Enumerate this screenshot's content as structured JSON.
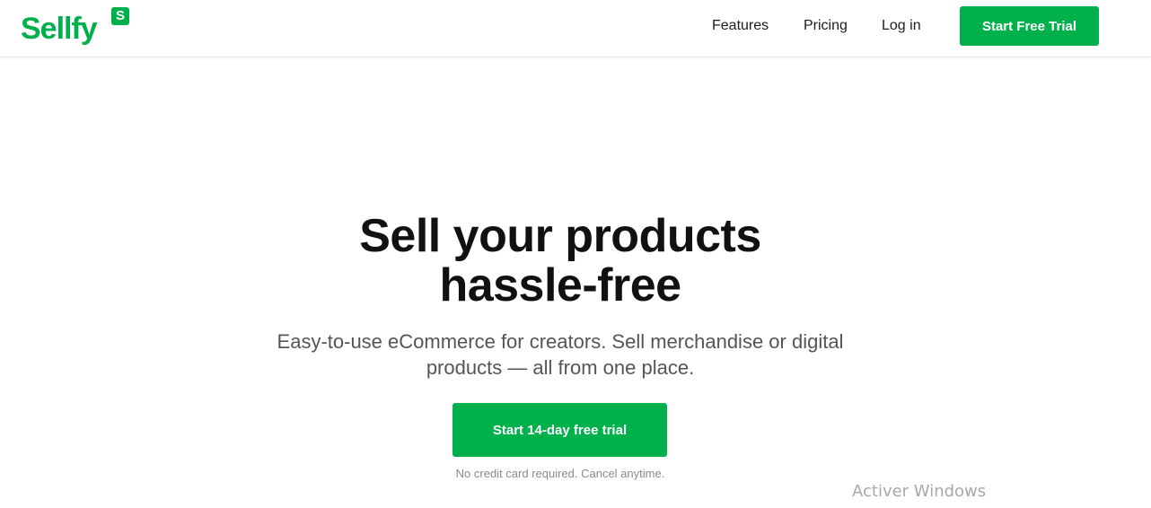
{
  "header": {
    "logo_text": "Sellfy",
    "logo_badge": "S",
    "nav": {
      "features": "Features",
      "pricing": "Pricing",
      "login": "Log in"
    },
    "cta_label": "Start Free Trial"
  },
  "hero": {
    "title_lines": [
      "Sell your products",
      "hassle-free"
    ],
    "subtitle_lines": [
      "Easy-to-use eCommerce for creators. Sell merchandise or digital",
      "products — all from one place."
    ],
    "cta_label": "Start 14-day free trial",
    "note": "No credit card required. Cancel anytime."
  },
  "os_overlay": {
    "watermark": "Activer Windows"
  },
  "colors": {
    "brand_green": "#00b04b",
    "text_dark": "#111111",
    "text_muted": "#555555",
    "note_gray": "#8a8a8a"
  }
}
